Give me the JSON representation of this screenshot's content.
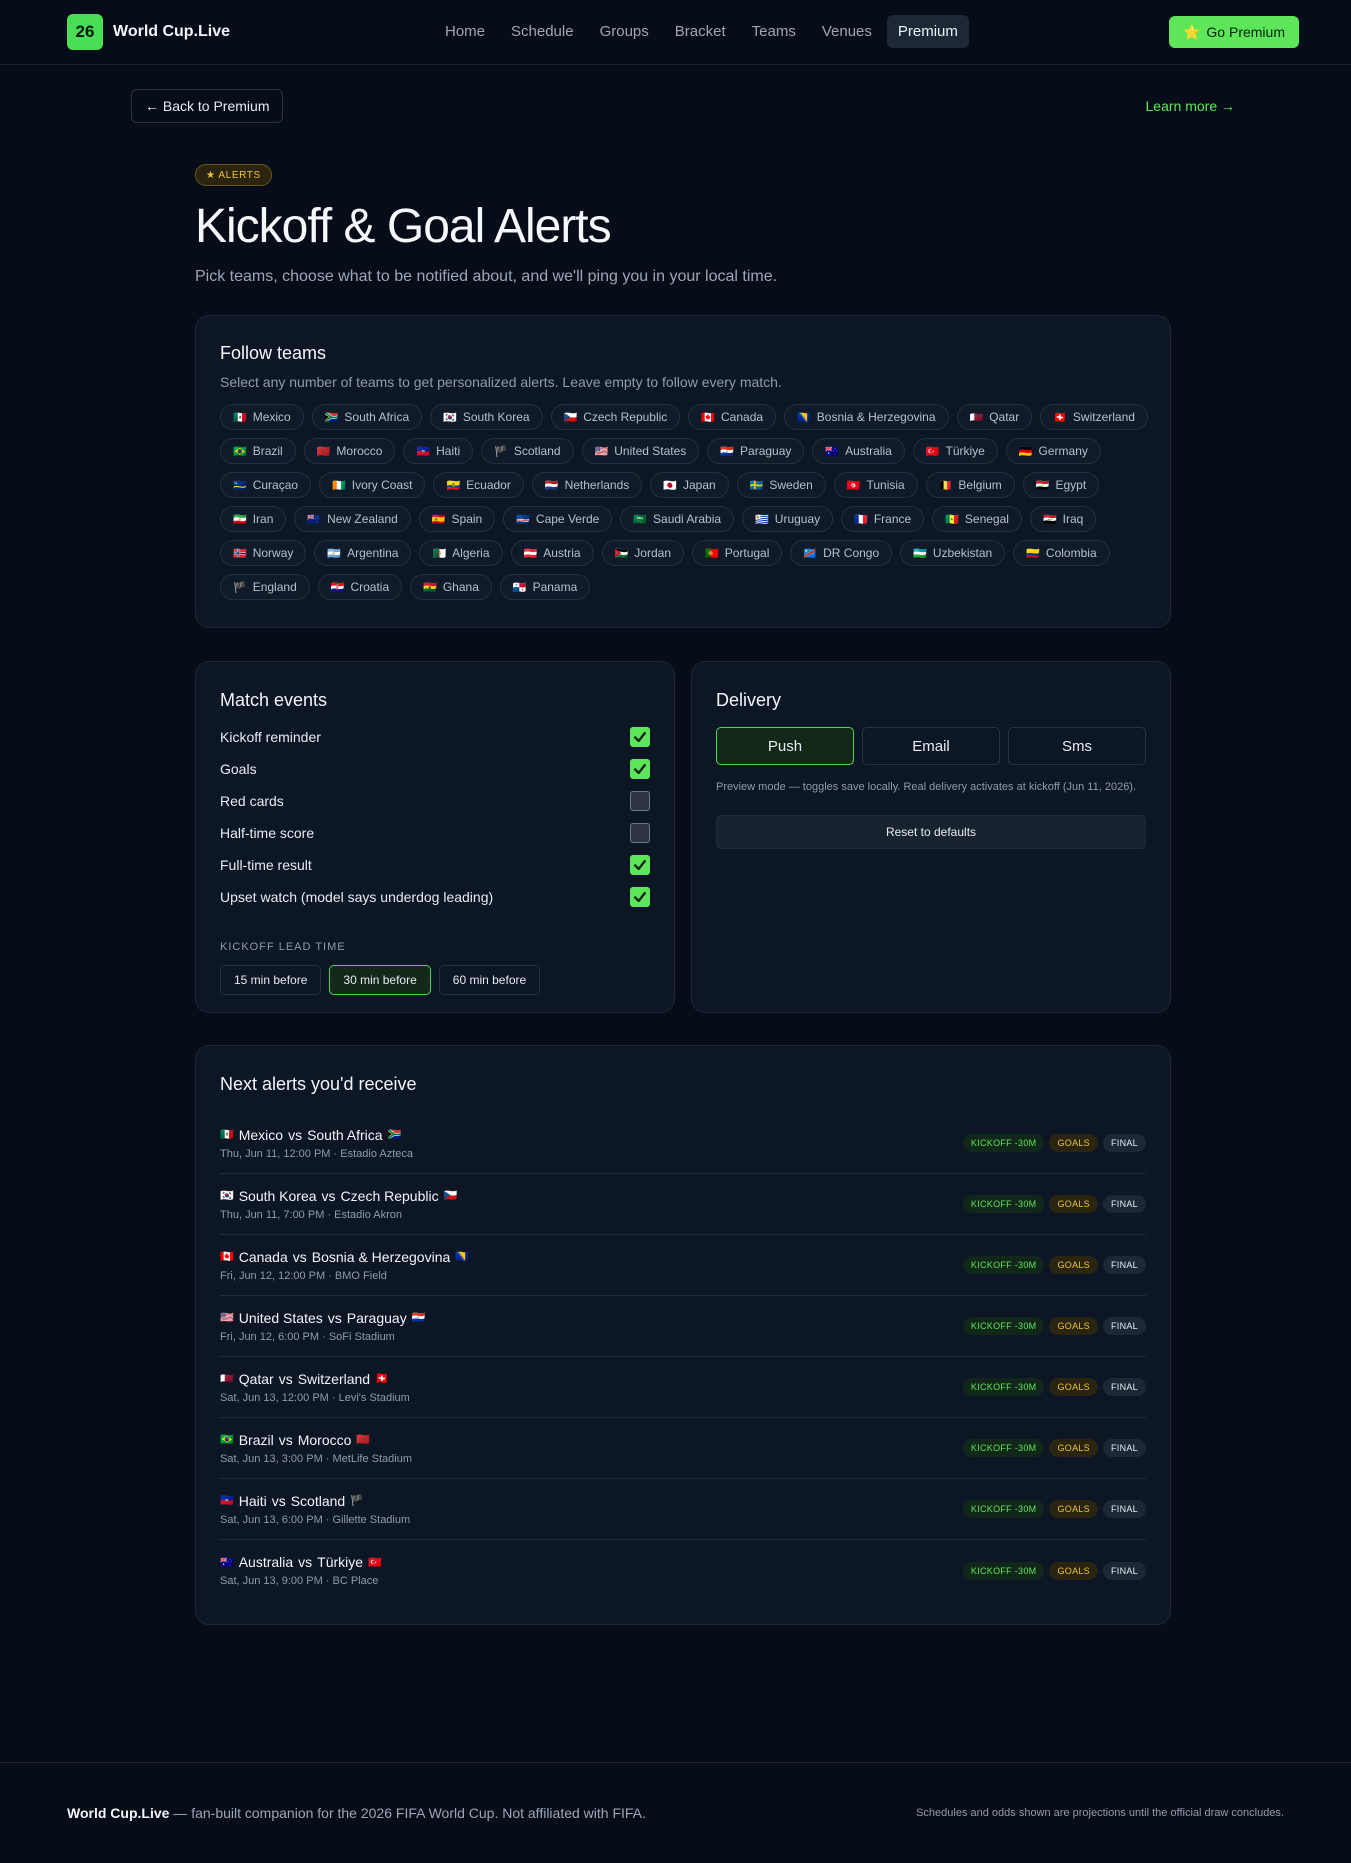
{
  "header": {
    "logo_badge": "26",
    "logo_text": "World Cup.Live",
    "nav": [
      "Home",
      "Schedule",
      "Groups",
      "Bracket",
      "Teams",
      "Venues",
      "Premium"
    ],
    "active_nav": "Premium",
    "cta": "Go Premium",
    "cta_icon": "⭐"
  },
  "back": {
    "label": "← Back to Premium",
    "learn_more": "Learn more →"
  },
  "hero": {
    "pill": "★ ALERTS",
    "title": "Kickoff & Goal Alerts",
    "lead": "Pick teams, choose what to be notified about, and we'll ping you in your local time."
  },
  "follow": {
    "title": "Follow teams",
    "subtitle": "Select any number of teams to get personalized alerts. Leave empty to follow every match.",
    "teams": [
      {
        "flag": "🇲🇽",
        "name": "Mexico"
      },
      {
        "flag": "🇿🇦",
        "name": "South Africa"
      },
      {
        "flag": "🇰🇷",
        "name": "South Korea"
      },
      {
        "flag": "🇨🇿",
        "name": "Czech Republic"
      },
      {
        "flag": "🇨🇦",
        "name": "Canada"
      },
      {
        "flag": "🇧🇦",
        "name": "Bosnia & Herzegovina"
      },
      {
        "flag": "🇶🇦",
        "name": "Qatar"
      },
      {
        "flag": "🇨🇭",
        "name": "Switzerland"
      },
      {
        "flag": "🇧🇷",
        "name": "Brazil"
      },
      {
        "flag": "🇲🇦",
        "name": "Morocco"
      },
      {
        "flag": "🇭🇹",
        "name": "Haiti"
      },
      {
        "flag": "🏴",
        "name": "Scotland"
      },
      {
        "flag": "🇺🇸",
        "name": "United States"
      },
      {
        "flag": "🇵🇾",
        "name": "Paraguay"
      },
      {
        "flag": "🇦🇺",
        "name": "Australia"
      },
      {
        "flag": "🇹🇷",
        "name": "Türkiye"
      },
      {
        "flag": "🇩🇪",
        "name": "Germany"
      },
      {
        "flag": "🇨🇼",
        "name": "Curaçao"
      },
      {
        "flag": "🇨🇮",
        "name": "Ivory Coast"
      },
      {
        "flag": "🇪🇨",
        "name": "Ecuador"
      },
      {
        "flag": "🇳🇱",
        "name": "Netherlands"
      },
      {
        "flag": "🇯🇵",
        "name": "Japan"
      },
      {
        "flag": "🇸🇪",
        "name": "Sweden"
      },
      {
        "flag": "🇹🇳",
        "name": "Tunisia"
      },
      {
        "flag": "🇧🇪",
        "name": "Belgium"
      },
      {
        "flag": "🇪🇬",
        "name": "Egypt"
      },
      {
        "flag": "🇮🇷",
        "name": "Iran"
      },
      {
        "flag": "🇳🇿",
        "name": "New Zealand"
      },
      {
        "flag": "🇪🇸",
        "name": "Spain"
      },
      {
        "flag": "🇨🇻",
        "name": "Cape Verde"
      },
      {
        "flag": "🇸🇦",
        "name": "Saudi Arabia"
      },
      {
        "flag": "🇺🇾",
        "name": "Uruguay"
      },
      {
        "flag": "🇫🇷",
        "name": "France"
      },
      {
        "flag": "🇸🇳",
        "name": "Senegal"
      },
      {
        "flag": "🇮🇶",
        "name": "Iraq"
      },
      {
        "flag": "🇳🇴",
        "name": "Norway"
      },
      {
        "flag": "🇦🇷",
        "name": "Argentina"
      },
      {
        "flag": "🇩🇿",
        "name": "Algeria"
      },
      {
        "flag": "🇦🇹",
        "name": "Austria"
      },
      {
        "flag": "🇯🇴",
        "name": "Jordan"
      },
      {
        "flag": "🇵🇹",
        "name": "Portugal"
      },
      {
        "flag": "🇨🇩",
        "name": "DR Congo"
      },
      {
        "flag": "🇺🇿",
        "name": "Uzbekistan"
      },
      {
        "flag": "🇨🇴",
        "name": "Colombia"
      },
      {
        "flag": "🏴",
        "name": "England"
      },
      {
        "flag": "🇭🇷",
        "name": "Croatia"
      },
      {
        "flag": "🇬🇭",
        "name": "Ghana"
      },
      {
        "flag": "🇵🇦",
        "name": "Panama"
      }
    ]
  },
  "events": {
    "title": "Match events",
    "items": [
      {
        "label": "Kickoff reminder",
        "checked": true
      },
      {
        "label": "Goals",
        "checked": true
      },
      {
        "label": "Red cards",
        "checked": false
      },
      {
        "label": "Half-time score",
        "checked": false
      },
      {
        "label": "Full-time result",
        "checked": true
      },
      {
        "label": "Upset watch (model says underdog leading)",
        "checked": true
      }
    ],
    "lead_label": "KICKOFF LEAD TIME",
    "lead_options": [
      "15 min before",
      "30 min before",
      "60 min before"
    ],
    "lead_selected": 1
  },
  "delivery": {
    "title": "Delivery",
    "channels": [
      "Push",
      "Email",
      "Sms"
    ],
    "selected": 0,
    "note": "Preview mode — toggles save locally. Real delivery activates at kickoff (Jun 11, 2026).",
    "reset": "Reset to defaults"
  },
  "next": {
    "title": "Next alerts you'd receive",
    "badges": {
      "kickoff": "KICKOFF -30M",
      "goals": "GOALS",
      "final": "FINAL"
    },
    "matches": [
      {
        "home_flag": "🇲🇽",
        "home": "Mexico",
        "away": "South Africa",
        "away_flag": "🇿🇦",
        "meta": "Thu, Jun 11, 12:00 PM · Estadio Azteca"
      },
      {
        "home_flag": "🇰🇷",
        "home": "South Korea",
        "away": "Czech Republic",
        "away_flag": "🇨🇿",
        "meta": "Thu, Jun 11, 7:00 PM · Estadio Akron"
      },
      {
        "home_flag": "🇨🇦",
        "home": "Canada",
        "away": "Bosnia & Herzegovina",
        "away_flag": "🇧🇦",
        "meta": "Fri, Jun 12, 12:00 PM · BMO Field"
      },
      {
        "home_flag": "🇺🇸",
        "home": "United States",
        "away": "Paraguay",
        "away_flag": "🇵🇾",
        "meta": "Fri, Jun 12, 6:00 PM · SoFi Stadium"
      },
      {
        "home_flag": "🇶🇦",
        "home": "Qatar",
        "away": "Switzerland",
        "away_flag": "🇨🇭",
        "meta": "Sat, Jun 13, 12:00 PM · Levi's Stadium"
      },
      {
        "home_flag": "🇧🇷",
        "home": "Brazil",
        "away": "Morocco",
        "away_flag": "🇲🇦",
        "meta": "Sat, Jun 13, 3:00 PM · MetLife Stadium"
      },
      {
        "home_flag": "🇭🇹",
        "home": "Haiti",
        "away": "Scotland",
        "away_flag": "🏴",
        "meta": "Sat, Jun 13, 6:00 PM · Gillette Stadium"
      },
      {
        "home_flag": "🇦🇺",
        "home": "Australia",
        "away": "Türkiye",
        "away_flag": "🇹🇷",
        "meta": "Sat, Jun 13, 9:00 PM · BC Place"
      }
    ]
  },
  "footer": {
    "brand": "World Cup.Live",
    "tagline": " — fan-built companion for the 2026 FIFA World Cup. Not affiliated with FIFA.",
    "note": "Schedules and odds shown are projections until the official draw concludes."
  }
}
